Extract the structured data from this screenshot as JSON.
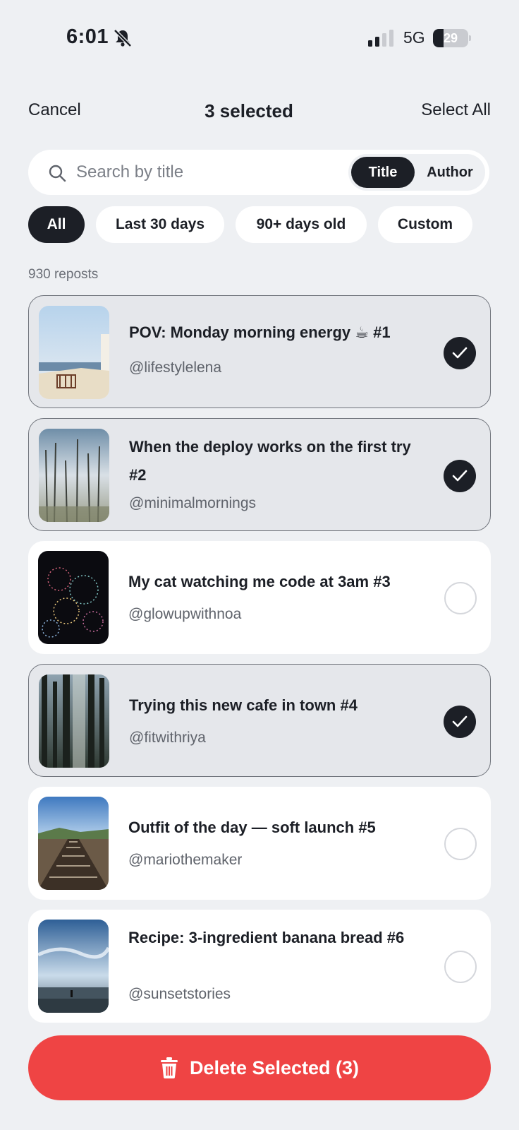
{
  "status_bar": {
    "time": "6:01",
    "network": "5G",
    "battery": "29",
    "battery_level": 0.29,
    "icons": [
      "bell-slash-icon",
      "signal-icon",
      "battery-icon"
    ]
  },
  "header": {
    "cancel_label": "Cancel",
    "title": "3 selected",
    "select_all_label": "Select All"
  },
  "search": {
    "placeholder": "Search by title",
    "value": "",
    "modes": [
      "Title",
      "Author"
    ],
    "active_mode": "Title"
  },
  "filters": {
    "chips": [
      "All",
      "Last 30 days",
      "90+ days old",
      "Custom"
    ],
    "active": "All"
  },
  "count_label": "930 reposts",
  "posts": [
    {
      "title": "POV: Monday morning energy ☕ #1",
      "author": "@lifestylelena",
      "selected": true
    },
    {
      "title": "When the deploy works on the first try #2",
      "author": "@minimalmornings",
      "selected": true
    },
    {
      "title": "My cat watching me code at 3am #3",
      "author": "@glowupwithnoa",
      "selected": false
    },
    {
      "title": "Trying this new cafe in town #4",
      "author": "@fitwithriya",
      "selected": true
    },
    {
      "title": "Outfit of the day — soft launch #5",
      "author": "@mariothemaker",
      "selected": false
    },
    {
      "title": "Recipe: 3-ingredient banana bread #6",
      "author": "@sunsetstories",
      "selected": false
    }
  ],
  "delete_button": {
    "label": "Delete Selected (3)",
    "icon": "trash-icon"
  },
  "colors": {
    "accent": "#1c1f26",
    "danger": "#ef4444",
    "background": "#eef0f3",
    "selected_card": "#e5e7eb"
  }
}
